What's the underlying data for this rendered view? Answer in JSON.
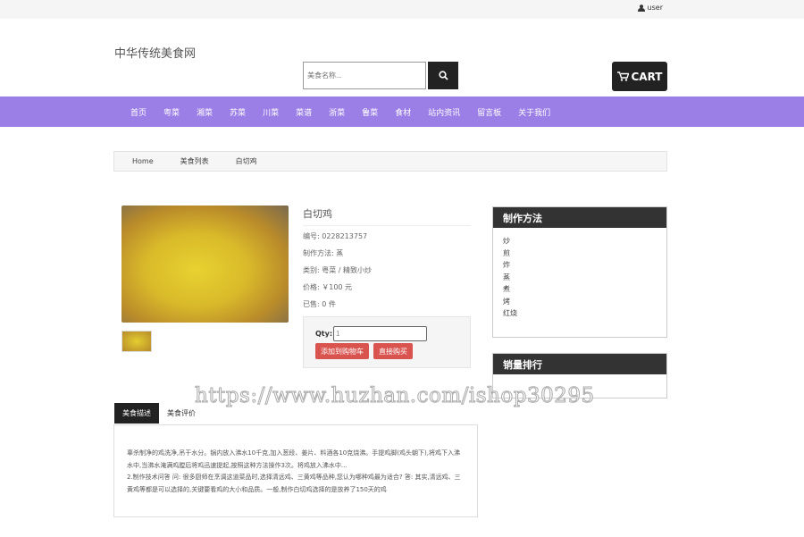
{
  "topbar": {
    "user": "user"
  },
  "header": {
    "logo": "中华传统美食网",
    "search_placeholder": "美食名称...",
    "cart": "CART"
  },
  "nav": [
    "首页",
    "粤菜",
    "湘菜",
    "苏菜",
    "川菜",
    "菜谱",
    "浙菜",
    "鲁菜",
    "食材",
    "站内资讯",
    "留言板",
    "关于我们"
  ],
  "breadcrumb": [
    "Home",
    "美食列表",
    "白切鸡"
  ],
  "product": {
    "title": "白切鸡",
    "code": "编号: 0228213757",
    "method": "制作方法: 蒸",
    "category": "类别: 粤菜 / 精致小炒",
    "price": "价格: ￥100 元",
    "sold": "已售: 0 件",
    "qty_label": "Qty:",
    "qty_value": "1",
    "add_cart": "添加到购物车",
    "buy_now": "直接购买"
  },
  "sidebar": {
    "methods_title": "制作方法",
    "methods": [
      "炒",
      "煎",
      "炸",
      "蒸",
      "煮",
      "烤",
      "红烧"
    ],
    "ranking_title": "销量排行"
  },
  "tabs": [
    "美食描述",
    "美食评价"
  ],
  "description": [
    "辜杀制净的鸡洗净,吊干水分。锅内放入沸水10千克,加入葱段、姜片、料酒各10克烧沸。手提鸡脚(鸡头朝下),将鸡下入沸水中,当沸水淹满鸡膛后将鸡迅速提起,按照这种方法操作3次。将鸡放入沸水中...",
    "2.制作技术问答 问: 很多厨师在烹调这道菜品时,选择清远鸡、三黄鸡等品种,您认为哪种鸡最为适合? 答: 其实,清远鸡、三黄鸡等都是可以选择的,关键要看鸡的大小和品质。一般,制作白切鸡选择的是放养了150天的鸡"
  ],
  "watermark": "https://www.huzhan.com/ishop30295"
}
